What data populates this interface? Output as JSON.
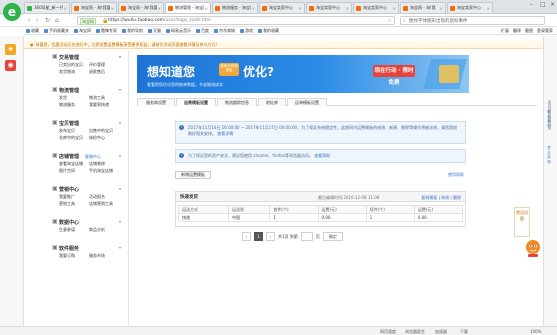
{
  "browser": {
    "tabs": [
      {
        "title": "360导航_新一代安全上网",
        "active": false,
        "color": "#2db34a"
      },
      {
        "title": "淘宝网 - 淘!我喜欢",
        "active": false,
        "color": "#f36a10"
      },
      {
        "title": "淘宝网 - 淘!我喜欢",
        "active": false,
        "color": "#f36a10"
      },
      {
        "title": "物流管理 - 淘宝网",
        "active": true,
        "color": "#f36a10"
      },
      {
        "title": "物流服务 - 淘宝网",
        "active": false,
        "color": "#f36a10"
      },
      {
        "title": "淘宝卖家中心",
        "active": false,
        "color": "#f36a10"
      },
      {
        "title": "淘宝卖家中心",
        "active": false,
        "color": "#f36a10"
      },
      {
        "title": "淘宝卖家中心",
        "active": false,
        "color": "#f36a10"
      },
      {
        "title": "淘宝网 - 淘!我",
        "active": false,
        "color": "#f36a10"
      },
      {
        "title": "淘宝卖家中心",
        "active": false,
        "color": "#f36a10"
      }
    ],
    "address": {
      "badge": "淘宝网",
      "url_host": "https://wuliu.taobao.com",
      "url_path": "/user/logis_tools.htm"
    },
    "search_placeholder": "图纹字体图形出现的鼠标事件",
    "bookmarks": [
      "收藏",
      "手机收藏夹",
      "淘宝网",
      "雷锋专家",
      "我的导航",
      "天猫",
      "网易云音乐",
      "百度",
      "京东商城",
      "游戏",
      "我的收藏"
    ],
    "bookmarks_right": [
      "扩展",
      "翻译",
      "截图",
      "登录管家"
    ],
    "status_bar": {
      "items": [
        "网页速度",
        "浏览器医生",
        "加速器",
        "下载",
        "100%"
      ]
    }
  },
  "notice": "恭喜您，优惠活动正在进行中，立即设置运费模板享受更多权益，请前往活动页面查看详情及参与方式！",
  "app_nav": {
    "groups": [
      {
        "title": "交易管理",
        "items": [
          "已卖出的宝贝",
          "评价管理",
          "发货物流",
          "退款售后"
        ]
      },
      {
        "title": "物流管理",
        "items": [
          "发货",
          "物流工具",
          "物流服务",
          "我要寄快递"
        ]
      },
      {
        "title": "宝贝管理",
        "items": [
          "发布宝贝",
          "出售中的宝贝",
          "仓库中的宝贝",
          "体检中心"
        ]
      },
      {
        "title": "店铺管理",
        "badge": "客服中心",
        "items": [
          "查看淘宝店铺",
          "店铺装修",
          "图片空间",
          "手机淘宝店铺"
        ]
      },
      {
        "title": "营销中心",
        "items": [
          "我要推广",
          "活动报名",
          "营销工具",
          "店铺营销工具"
        ]
      },
      {
        "title": "数据中心",
        "items": [
          "生意参谋",
          "商品分析"
        ]
      },
      {
        "title": "软件服务",
        "items": [
          "我要订购",
          "服务市场"
        ]
      }
    ]
  },
  "banner": {
    "title_left": "想知道您",
    "tag": "账单分析快递费",
    "title_right": "优化?",
    "subtitle": "看看帮您优化您的账单数据，节省物流成本",
    "cta": "现在行动 · 限时免费"
  },
  "subtabs": [
    "服务商设置",
    "运费模板设置",
    "物流跟踪信息",
    "地址库",
    "运单模板设置"
  ],
  "active_subtab": 1,
  "info_box_1": {
    "text": "2017年11月16日 16:00:00 ~ 2017年11月17日 00:00:00，为了保证系统稳定性，此期间内运费模板的修改、新建、删除等操作将被冻结，请您提前做好相关安排。",
    "link": "查看详情"
  },
  "info_box_2": {
    "text": "为了保证您的资产安全，建议您使用 chrome、firefox等浏览器访问。",
    "link": "查看帮助"
  },
  "new_template_button": "新增运费模板",
  "usage_help": "使用帮助",
  "template": {
    "name": "快递发货",
    "last_edited": "最后编辑时间:2016-12-08 11:08",
    "actions": [
      "复制模板",
      "修改",
      "删除"
    ],
    "columns": [
      "运送方式",
      "运送到",
      "首件(个)",
      "运费(元)",
      "续件(个)",
      "运费(元)"
    ],
    "rows": [
      [
        "快递",
        "中国",
        "1",
        "0.00",
        "1",
        "0.00"
      ]
    ]
  },
  "pagination": {
    "prev": "‹",
    "current": "1",
    "next": "›",
    "total": "共1页 到第",
    "unit": "页",
    "go": "确定"
  },
  "floating": {
    "help": "常见问题",
    "side_links": [
      "联系我们",
      "意见反馈"
    ]
  }
}
